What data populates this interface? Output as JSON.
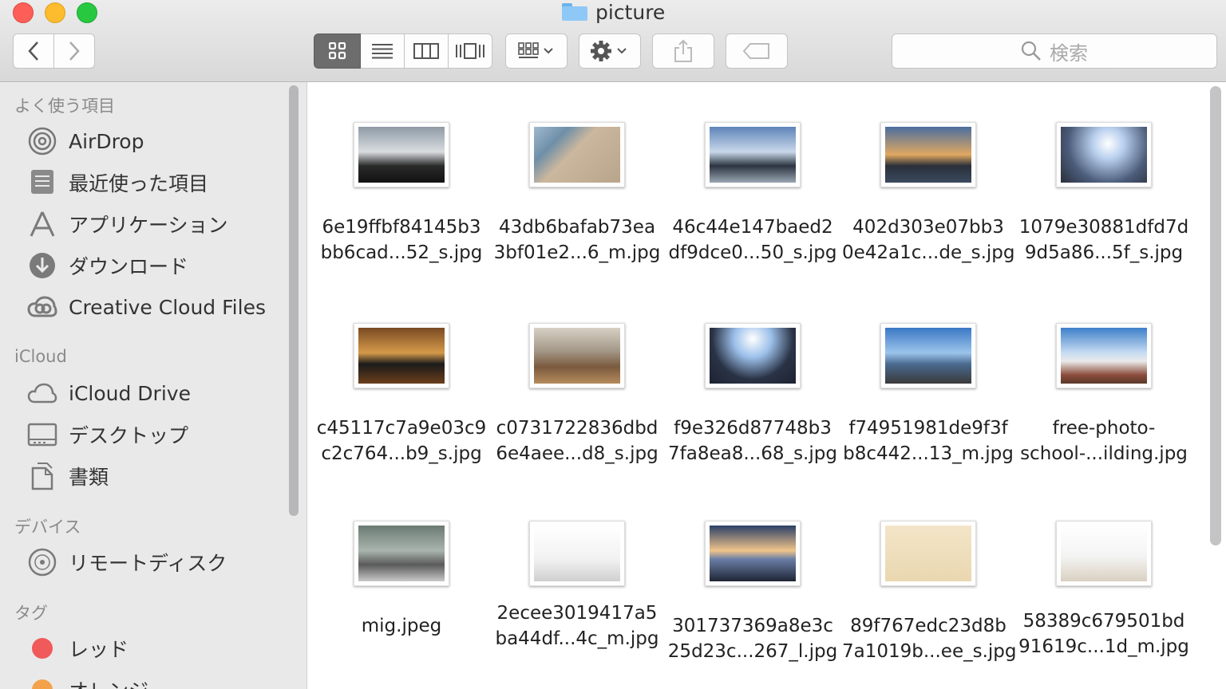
{
  "window": {
    "title": "picture"
  },
  "toolbar": {
    "search_placeholder": "検索",
    "icons": {
      "back": "chevron-left-icon",
      "forward": "chevron-right-icon",
      "icon_view": "icon-view-icon",
      "list_view": "list-view-icon",
      "column_view": "column-view-icon",
      "gallery_view": "coverflow-icon",
      "arrange": "arrange-icon",
      "action": "gear-icon",
      "share": "share-icon",
      "tag": "tag-icon",
      "search": "search-icon"
    }
  },
  "sidebar": {
    "favorites_title": "よく使う項目",
    "favorites": [
      {
        "label": "AirDrop",
        "icon": "airdrop-icon"
      },
      {
        "label": "最近使った項目",
        "icon": "recents-icon"
      },
      {
        "label": "アプリケーション",
        "icon": "applications-icon"
      },
      {
        "label": "ダウンロード",
        "icon": "download-icon"
      },
      {
        "label": "Creative Cloud Files",
        "icon": "creative-cloud-icon"
      }
    ],
    "icloud_title": "iCloud",
    "icloud": [
      {
        "label": "iCloud Drive",
        "icon": "cloud-icon"
      },
      {
        "label": "デスクトップ",
        "icon": "desktop-icon"
      },
      {
        "label": "書類",
        "icon": "documents-icon"
      }
    ],
    "devices_title": "デバイス",
    "devices": [
      {
        "label": "リモートディスク",
        "icon": "disc-icon"
      }
    ],
    "tags_title": "タグ",
    "tags": [
      {
        "label": "レッド",
        "color": "#f05a5a"
      },
      {
        "label": "オレンジ",
        "color": "#f4a24a"
      }
    ]
  },
  "files": [
    {
      "line1": "6e19ffbf84145b3",
      "line2": "bb6cad...52_s.jpg"
    },
    {
      "line1": "43db6bafab73ea",
      "line2": "3bf01e2...6_m.jpg"
    },
    {
      "line1": "46c44e147baed2",
      "line2": "df9dce0...50_s.jpg"
    },
    {
      "line1": "402d303e07bb3",
      "line2": "0e42a1c...de_s.jpg"
    },
    {
      "line1": "1079e30881dfd7d",
      "line2": "9d5a86...5f_s.jpg"
    },
    {
      "line1": "c45117c7a9e03c9",
      "line2": "c2c764...b9_s.jpg"
    },
    {
      "line1": "c0731722836dbd",
      "line2": "6e4aee...d8_s.jpg"
    },
    {
      "line1": "f9e326d87748b3",
      "line2": "7fa8ea8...68_s.jpg"
    },
    {
      "line1": "f74951981de9f3f",
      "line2": "b8c442...13_m.jpg"
    },
    {
      "line1": "free-photo-",
      "line2": "school-...ilding.jpg"
    },
    {
      "line1": "mig.jpeg",
      "line2": ""
    },
    {
      "line1": "2ecee3019417a5",
      "line2": "ba44df...4c_m.jpg"
    },
    {
      "line1": "301737369a8e3c",
      "line2": "25d23c...267_l.jpg"
    },
    {
      "line1": "89f767edc23d8b",
      "line2": "7a1019b...ee_s.jpg"
    },
    {
      "line1": "58389c679501bd",
      "line2": "91619c...1d_m.jpg"
    }
  ]
}
